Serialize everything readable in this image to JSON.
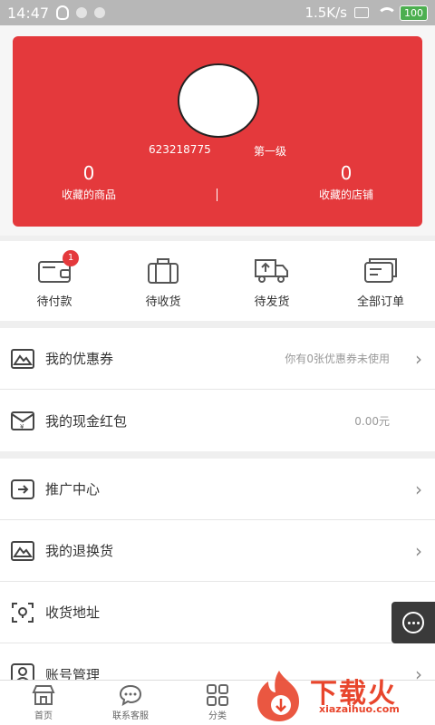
{
  "status_bar": {
    "time": "14:47",
    "speed": "1.5K/s",
    "battery": "100"
  },
  "profile": {
    "user_id": "623218775",
    "level": "第一级",
    "stats": [
      {
        "value": "0",
        "label": "收藏的商品"
      },
      {
        "value": "0",
        "label": "收藏的店铺"
      }
    ]
  },
  "orders": [
    {
      "label": "待付款",
      "badge": "1",
      "icon": "wallet-icon"
    },
    {
      "label": "待收货",
      "icon": "suitcase-icon"
    },
    {
      "label": "待发货",
      "icon": "truck-icon"
    },
    {
      "label": "全部订单",
      "icon": "card-icon"
    }
  ],
  "wallet_section": [
    {
      "title": "我的优惠券",
      "note": "你有0张优惠券未使用",
      "icon": "coupon-icon"
    },
    {
      "title": "我的现金红包",
      "note": "0.00元",
      "icon": "red-packet-icon"
    }
  ],
  "service_section": [
    {
      "title": "推广中心",
      "icon": "promotion-icon"
    },
    {
      "title": "我的退换货",
      "icon": "return-icon"
    },
    {
      "title": "收货地址",
      "icon": "location-icon"
    },
    {
      "title": "账号管理",
      "icon": "account-icon"
    }
  ],
  "tabbar": [
    {
      "label": "首页",
      "icon": "store-icon"
    },
    {
      "label": "联系客服",
      "icon": "chat-icon"
    },
    {
      "label": "分类",
      "icon": "grid-icon"
    }
  ],
  "watermark": {
    "cn": "下载火",
    "en": "xiazaihuo.com"
  }
}
